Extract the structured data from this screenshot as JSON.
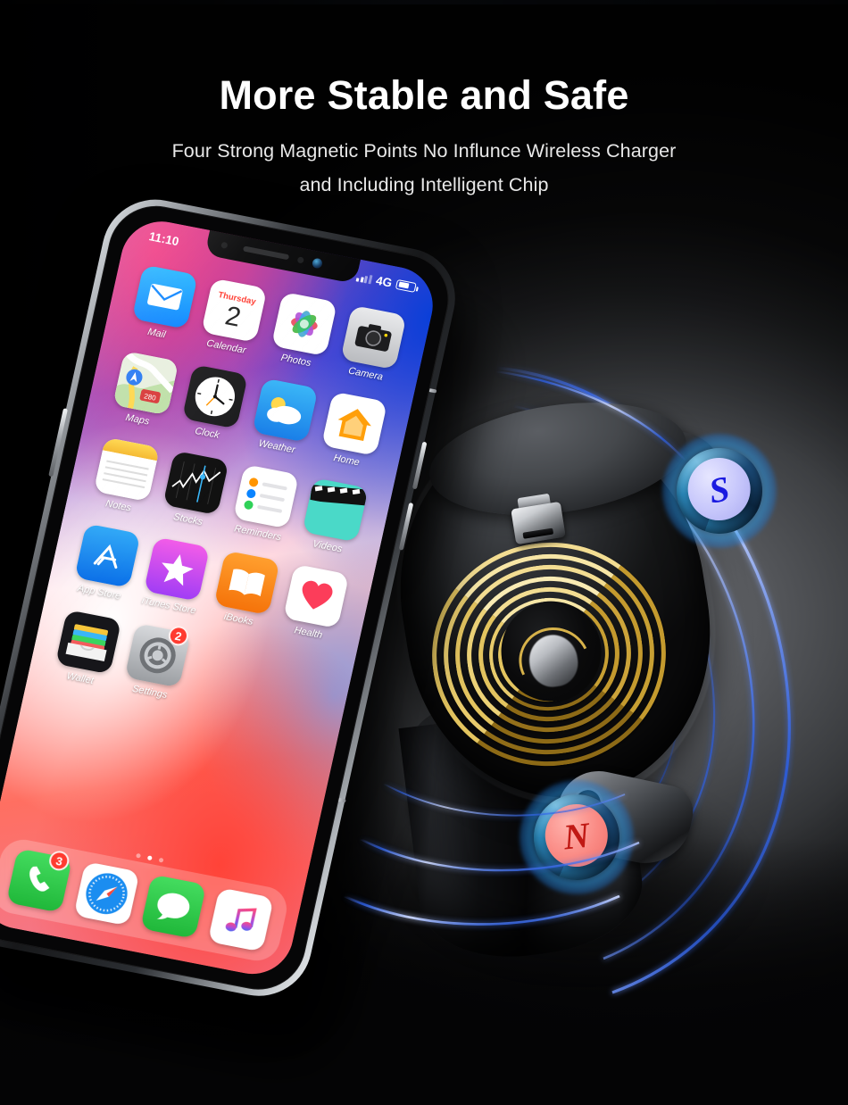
{
  "banner": {
    "title": "More Stable and Safe",
    "subtitle_line1": "Four Strong Magnetic Points No Influnce Wireless Charger",
    "subtitle_line2": "and Including Intelligent Chip"
  },
  "colors": {
    "background": "#0a0a0a",
    "title_text": "#ffffff",
    "subtitle_text": "#e8e8e8",
    "field_line": "#1f4fe0",
    "coil_gold": "#e6c257",
    "pole_south_fill": "#c6c6fb",
    "pole_south_glyph": "#1a1ae0",
    "pole_north_fill": "#fa8a84",
    "pole_north_glyph": "#c01914",
    "top_band": "#48597a"
  },
  "device": {
    "name": "magnetic-wireless-car-charger-mount",
    "poles": [
      {
        "id": "south",
        "label": "S"
      },
      {
        "id": "north",
        "label": "N"
      }
    ],
    "coil": {
      "name": "wireless-charging-coil",
      "turns": 9
    },
    "connector": {
      "name": "micro-usb-connector"
    },
    "field_arcs": 8
  },
  "phone": {
    "model": "iphone-x",
    "status_bar": {
      "time": "11:10",
      "network": "4G",
      "signal_bars": 4,
      "battery_level": 55
    },
    "page_dots": {
      "count": 3,
      "active_index": 1
    },
    "apps": [
      {
        "name": "Mail",
        "icon": "mail-icon"
      },
      {
        "name": "Calendar",
        "icon": "calendar-icon",
        "weekday": "Thursday",
        "day": "2"
      },
      {
        "name": "Photos",
        "icon": "photos-icon"
      },
      {
        "name": "Camera",
        "icon": "camera-icon"
      },
      {
        "name": "Maps",
        "icon": "maps-icon"
      },
      {
        "name": "Clock",
        "icon": "clock-icon"
      },
      {
        "name": "Weather",
        "icon": "weather-icon"
      },
      {
        "name": "Home",
        "icon": "home-icon"
      },
      {
        "name": "Notes",
        "icon": "notes-icon"
      },
      {
        "name": "Stocks",
        "icon": "stocks-icon"
      },
      {
        "name": "Reminders",
        "icon": "reminders-icon"
      },
      {
        "name": "Videos",
        "icon": "videos-icon"
      },
      {
        "name": "App Store",
        "icon": "app-store-icon"
      },
      {
        "name": "iTunes Store",
        "icon": "itunes-store-icon"
      },
      {
        "name": "iBooks",
        "icon": "ibooks-icon"
      },
      {
        "name": "Health",
        "icon": "health-icon"
      },
      {
        "name": "Wallet",
        "icon": "wallet-icon"
      },
      {
        "name": "Settings",
        "icon": "settings-icon",
        "badge": "2"
      }
    ],
    "dock": [
      {
        "name": "Phone",
        "icon": "phone-icon",
        "badge": "3"
      },
      {
        "name": "Safari",
        "icon": "safari-icon"
      },
      {
        "name": "Messages",
        "icon": "messages-icon"
      },
      {
        "name": "Music",
        "icon": "music-icon"
      }
    ]
  }
}
